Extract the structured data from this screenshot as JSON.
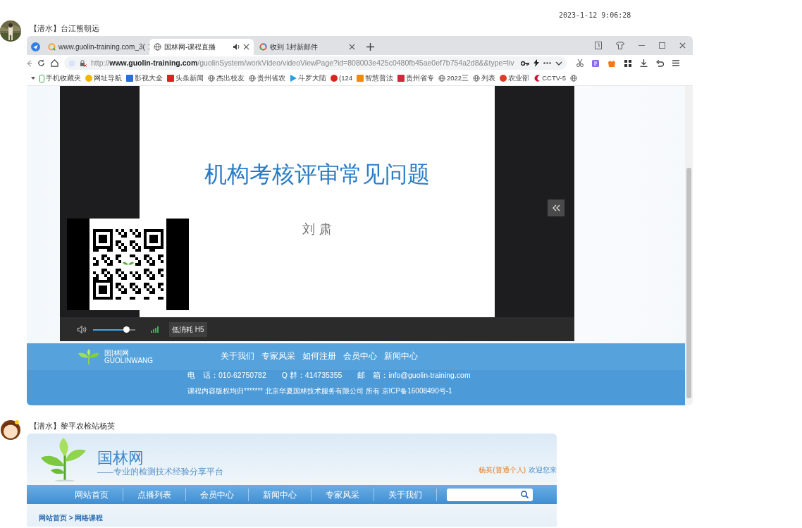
{
  "timestamp": "2023-1-12 9:06:28",
  "messages": [
    {
      "sender": "【潜水】台江熊朝远",
      "screenshot": {
        "kind": "browser",
        "tabs": [
          {
            "label": "www.guolin-training.com_3(",
            "kind": "ring",
            "selected": false,
            "audio": false
          },
          {
            "label": "国林网-课程直播",
            "kind": "globe",
            "selected": true,
            "audio": true
          },
          {
            "label": "收到 1封新邮件",
            "kind": "mail",
            "selected": false,
            "audio": false
          }
        ],
        "url": {
          "scheme": "http://",
          "host": "www.guolin-training.com",
          "path": "/guolinSystem/workVideo/videoViewPage?id=808003e425c0480fb45ae0ef7b754a2d8&&type=liv"
        },
        "bookmarks": [
          {
            "label": "手机收藏夹",
            "kind": "phone",
            "color": "#22aa44"
          },
          {
            "label": "网址导航",
            "kind": "circle",
            "color": "#f2b600"
          },
          {
            "label": "影视大全",
            "kind": "square",
            "color": "#2a6fd6"
          },
          {
            "label": "头条新闻",
            "kind": "square",
            "color": "#e02020"
          },
          {
            "label": "杰出校友",
            "kind": "globe"
          },
          {
            "label": "贵州省农",
            "kind": "globe"
          },
          {
            "label": "斗罗大陆",
            "kind": "play",
            "color": "#1fa0e8"
          },
          {
            "label": "(124",
            "kind": "circle",
            "color": "#d9261c"
          },
          {
            "label": "智慧普法",
            "kind": "square",
            "color": "#f08c00"
          },
          {
            "label": "贵州省专",
            "kind": "square",
            "color": "#d6263a"
          },
          {
            "label": "2022三",
            "kind": "globe"
          },
          {
            "label": "列表",
            "kind": "globe"
          },
          {
            "label": "农业部",
            "kind": "circle",
            "color": "#e03a2a"
          },
          {
            "label": "CCTV-5",
            "kind": "c",
            "color": "#c8102e"
          },
          {
            "kind": "globe"
          }
        ],
        "player": {
          "slide_title": "机构考核评审常见问题",
          "slide_author": "刘 肃",
          "volume": {
            "level": 0.78
          },
          "quality": "低消耗 H5"
        },
        "footer": {
          "logo_name": "国|林|网",
          "logo_latin": "GUOLINWANG",
          "nav": [
            "关于我们",
            "专家风采",
            "如何注册",
            "会员中心",
            "新闻中心"
          ],
          "contacts": [
            "电　话：010-62750782",
            "Q 群：414735355",
            "邮　箱：info@guolin-training.com"
          ],
          "copyright": "课程内容版权均归******* 北京华夏国林技术服务有限公司 所有 京ICP备16008490号-1"
        }
      }
    },
    {
      "sender": "【潜水】黎平农检站杨英",
      "screenshot": {
        "kind": "site",
        "title": "国林网",
        "subtitle": "——专业的检测技术经验分享平台",
        "user": "杨英(普通个人)",
        "welcome": "欢迎您来",
        "nav": [
          "网站首页",
          "点播列表",
          "会员中心",
          "新闻中心",
          "专家风采",
          "关于我们"
        ],
        "breadcrumb": "网站首页 > 网络课程"
      }
    }
  ]
}
